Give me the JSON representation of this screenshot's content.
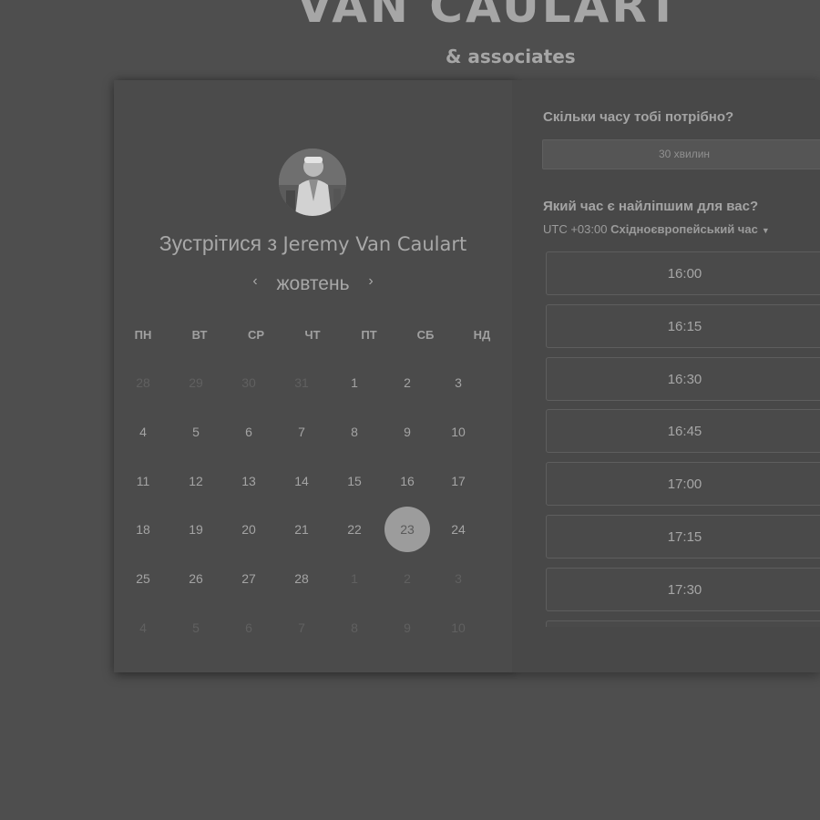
{
  "brand": {
    "name": "VAN CAULART",
    "subtitle": "& associates"
  },
  "calendar": {
    "meet_prefix": "Зустрітися з ",
    "meet_name": "Jeremy Van Caulart",
    "month": "жовтень",
    "weekdays": [
      "ПН",
      "ВТ",
      "СР",
      "ЧТ",
      "ПТ",
      "СБ",
      "НД"
    ],
    "weeks": [
      [
        "28",
        "29",
        "30",
        "31",
        "1",
        "2",
        "3"
      ],
      [
        "4",
        "5",
        "6",
        "7",
        "8",
        "9",
        "10"
      ],
      [
        "11",
        "12",
        "13",
        "14",
        "15",
        "16",
        "17"
      ],
      [
        "18",
        "19",
        "20",
        "21",
        "22",
        "23",
        "24"
      ],
      [
        "25",
        "26",
        "27",
        "28",
        "1",
        "2",
        "3"
      ],
      [
        "4",
        "5",
        "6",
        "7",
        "8",
        "9",
        "10"
      ]
    ],
    "muted_days": [
      [
        0,
        0
      ],
      [
        0,
        1
      ],
      [
        0,
        2
      ],
      [
        0,
        3
      ],
      [
        4,
        4
      ],
      [
        4,
        5
      ],
      [
        4,
        6
      ],
      [
        5,
        0
      ],
      [
        5,
        1
      ],
      [
        5,
        2
      ],
      [
        5,
        3
      ],
      [
        5,
        4
      ],
      [
        5,
        5
      ],
      [
        5,
        6
      ]
    ],
    "selected_day": "23"
  },
  "booking": {
    "duration_question": "Скільки часу тобі потрібно?",
    "duration_value": "30 хвилин",
    "time_question": "Який час є найліпшим для вас?",
    "timezone_offset": "UTC +03:00",
    "timezone_name": "Східноєвропейський час",
    "slots": [
      "16:00",
      "16:15",
      "16:30",
      "16:45",
      "17:00",
      "17:15",
      "17:30",
      ""
    ]
  },
  "icons": {
    "prev": "chevron-left-icon",
    "next": "chevron-right-icon",
    "timezone": "caret-down-icon"
  },
  "colors": {
    "background": "#4e4e4e",
    "selected_day": "#9c9c9c"
  }
}
